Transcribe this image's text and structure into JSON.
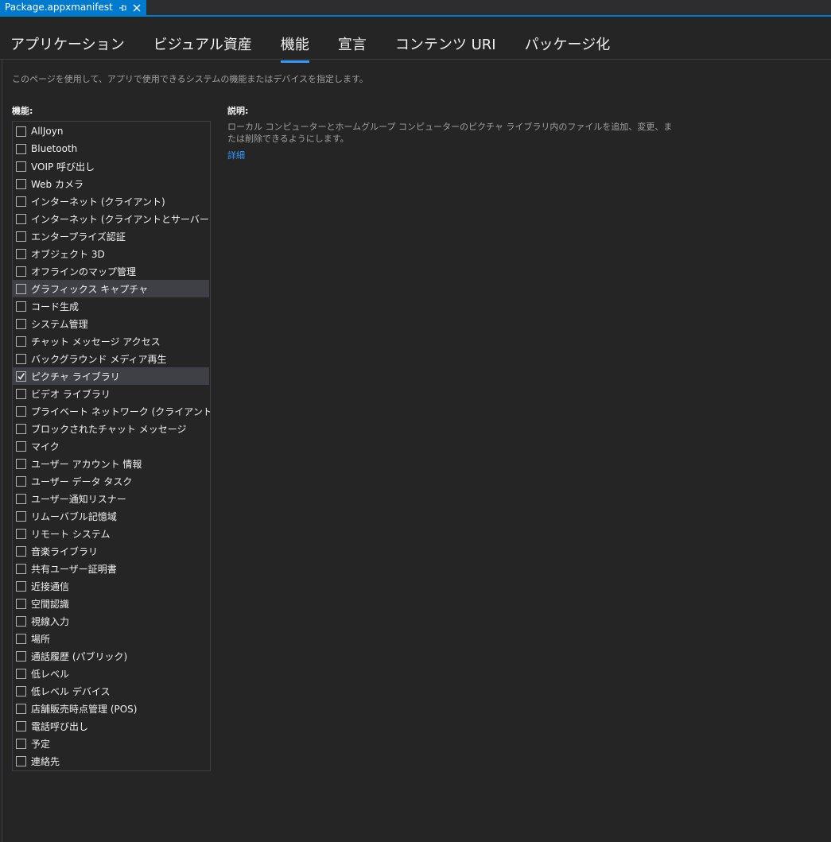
{
  "document_tab": {
    "title": "Package.appxmanifest",
    "pin_icon": "pin-icon",
    "close_icon": "close-icon"
  },
  "nav_tabs": [
    {
      "label": "アプリケーション",
      "active": false
    },
    {
      "label": "ビジュアル資産",
      "active": false
    },
    {
      "label": "機能",
      "active": true
    },
    {
      "label": "宣言",
      "active": false
    },
    {
      "label": "コンテンツ URI",
      "active": false
    },
    {
      "label": "パッケージ化",
      "active": false
    }
  ],
  "page_description": "このページを使用して、アプリで使用できるシステムの機能またはデバイスを指定します。",
  "capabilities": {
    "label": "機能:",
    "items": [
      {
        "label": "AllJoyn",
        "checked": false
      },
      {
        "label": "Bluetooth",
        "checked": false
      },
      {
        "label": "VOIP 呼び出し",
        "checked": false
      },
      {
        "label": "Web カメラ",
        "checked": false
      },
      {
        "label": "インターネット (クライアント)",
        "checked": false
      },
      {
        "label": "インターネット (クライアントとサーバー)",
        "checked": false
      },
      {
        "label": "エンタープライズ認証",
        "checked": false
      },
      {
        "label": "オブジェクト 3D",
        "checked": false
      },
      {
        "label": "オフラインのマップ管理",
        "checked": false
      },
      {
        "label": "グラフィックス キャプチャ",
        "checked": false,
        "highlight": true
      },
      {
        "label": "コード生成",
        "checked": false
      },
      {
        "label": "システム管理",
        "checked": false
      },
      {
        "label": "チャット メッセージ アクセス",
        "checked": false
      },
      {
        "label": "バックグラウンド メディア再生",
        "checked": false
      },
      {
        "label": "ピクチャ ライブラリ",
        "checked": true,
        "highlight": true
      },
      {
        "label": "ビデオ ライブラリ",
        "checked": false
      },
      {
        "label": "プライベート ネットワーク (クライアントとサーバー)",
        "checked": false
      },
      {
        "label": "ブロックされたチャット メッセージ",
        "checked": false
      },
      {
        "label": "マイク",
        "checked": false
      },
      {
        "label": "ユーザー アカウント 情報",
        "checked": false
      },
      {
        "label": "ユーザー データ タスク",
        "checked": false
      },
      {
        "label": "ユーザー通知リスナー",
        "checked": false
      },
      {
        "label": "リムーバブル記憶域",
        "checked": false
      },
      {
        "label": "リモート システム",
        "checked": false
      },
      {
        "label": "音楽ライブラリ",
        "checked": false
      },
      {
        "label": "共有ユーザー証明書",
        "checked": false
      },
      {
        "label": "近接通信",
        "checked": false
      },
      {
        "label": "空間認識",
        "checked": false
      },
      {
        "label": "視線入力",
        "checked": false
      },
      {
        "label": "場所",
        "checked": false
      },
      {
        "label": "通話履歴 (パブリック)",
        "checked": false
      },
      {
        "label": "低レベル",
        "checked": false
      },
      {
        "label": "低レベル デバイス",
        "checked": false
      },
      {
        "label": "店舗販売時点管理 (POS)",
        "checked": false
      },
      {
        "label": "電話呼び出し",
        "checked": false
      },
      {
        "label": "予定",
        "checked": false
      },
      {
        "label": "連絡先",
        "checked": false
      }
    ]
  },
  "description": {
    "title": "説明:",
    "text": "ローカル コンピューターとホームグループ コンピューターのピクチャ ライブラリ内のファイルを追加、変更、または削除できるようにします。",
    "link": "詳細"
  },
  "colors": {
    "background": "#252526",
    "accent": "#007acc",
    "link": "#3399ff",
    "highlight_row": "#3f3f46"
  }
}
